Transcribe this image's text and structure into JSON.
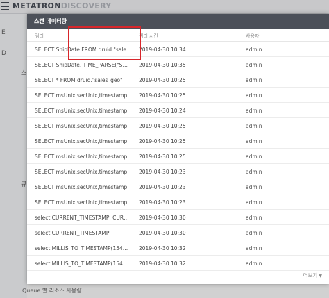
{
  "app": {
    "brand_primary": "METATRON",
    "brand_secondary": "DISCOVERY"
  },
  "background": {
    "side_frags": [
      "E",
      "D",
      "스",
      "큐"
    ],
    "footer_text": "Queue 별 리소스 사용량"
  },
  "modal": {
    "title": "스캔 데이터량",
    "columns": {
      "query": "쿼리",
      "time": "쿼리 시간",
      "user": "사용자"
    },
    "rows": [
      {
        "query": "SELECT ShipDate FROM druid.\"sale…",
        "time": "2019-04-30 10:34",
        "user": "admin"
      },
      {
        "query": "SELECT ShipDate, TIME_PARSE(\"S…",
        "time": "2019-04-30 10:35",
        "user": "admin"
      },
      {
        "query": "SELECT * FROM druid.\"sales_geo\"",
        "time": "2019-04-30 10:25",
        "user": "admin"
      },
      {
        "query": "SELECT msUnix,secUnix,timestamp…",
        "time": "2019-04-30 10:25",
        "user": "admin"
      },
      {
        "query": "SELECT msUnix,secUnix,timestamp…",
        "time": "2019-04-30 10:24",
        "user": "admin"
      },
      {
        "query": "SELECT msUnix,secUnix,timestamp…",
        "time": "2019-04-30 10:25",
        "user": "admin"
      },
      {
        "query": "SELECT msUnix,secUnix,timestamp…",
        "time": "2019-04-30 10:25",
        "user": "admin"
      },
      {
        "query": "SELECT msUnix,secUnix,timestamp…",
        "time": "2019-04-30 10:25",
        "user": "admin"
      },
      {
        "query": "SELECT msUnix,secUnix,timestamp…",
        "time": "2019-04-30 10:23",
        "user": "admin"
      },
      {
        "query": "SELECT msUnix,secUnix,timestamp…",
        "time": "2019-04-30 10:23",
        "user": "admin"
      },
      {
        "query": "SELECT msUnix,secUnix,timestamp…",
        "time": "2019-04-30 10:23",
        "user": "admin"
      },
      {
        "query": "select CURRENT_TIMESTAMP, CUR…",
        "time": "2019-04-30 10:30",
        "user": "admin"
      },
      {
        "query": "select CURRENT_TIMESTAMP",
        "time": "2019-04-30 10:30",
        "user": "admin"
      },
      {
        "query": "select MILLIS_TO_TIMESTAMP(154…",
        "time": "2019-04-30 10:32",
        "user": "admin"
      },
      {
        "query": "select MILLIS_TO_TIMESTAMP(154…",
        "time": "2019-04-30 10:32",
        "user": "admin"
      }
    ],
    "more_label": "더보기",
    "more_icon": "chevron-down-icon"
  },
  "colors": {
    "modal_header": "#4c5059",
    "highlight": "#d8262b"
  }
}
